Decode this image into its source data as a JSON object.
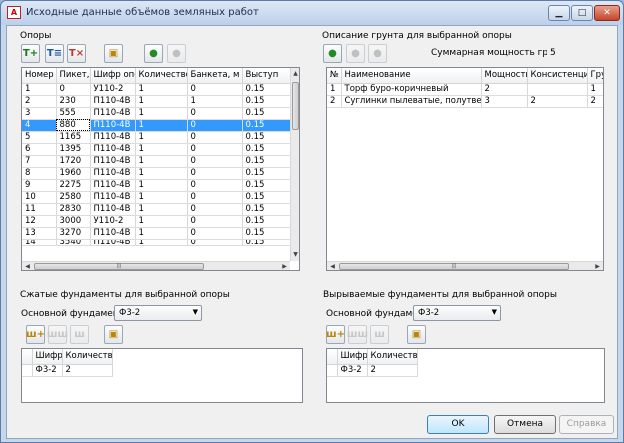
{
  "window": {
    "title": "Исходные данные объёмов земляных работ",
    "app_icon": "autocad-icon",
    "buttons": [
      "minimize-icon",
      "maximize-icon",
      "close-icon"
    ]
  },
  "supports": {
    "section_label": "Опоры",
    "headers": [
      "Номер",
      "Пикет, м",
      "Шифр опоры",
      "Количество",
      "Банкета, м",
      "Выступ"
    ],
    "rows": [
      [
        "1",
        "0",
        "У110-2",
        "1",
        "0",
        "0.15"
      ],
      [
        "2",
        "230",
        "П110-4В",
        "1",
        "1",
        "0.15"
      ],
      [
        "3",
        "555",
        "П110-4В",
        "1",
        "0",
        "0.15"
      ],
      [
        "4",
        "880",
        "П110-4В",
        "1",
        "0",
        "0.15"
      ],
      [
        "5",
        "1165",
        "П110-4В",
        "1",
        "0",
        "0.15"
      ],
      [
        "6",
        "1395",
        "П110-4В",
        "1",
        "0",
        "0.15"
      ],
      [
        "7",
        "1720",
        "П110-4В",
        "1",
        "0",
        "0.15"
      ],
      [
        "8",
        "1960",
        "П110-4В",
        "1",
        "0",
        "0.15"
      ],
      [
        "9",
        "2275",
        "П110-4В",
        "1",
        "0",
        "0.15"
      ],
      [
        "10",
        "2580",
        "П110-4В",
        "1",
        "0",
        "0.15"
      ],
      [
        "11",
        "2830",
        "П110-4В",
        "1",
        "0",
        "0.15"
      ],
      [
        "12",
        "3000",
        "У110-2",
        "1",
        "0",
        "0.15"
      ],
      [
        "13",
        "3270",
        "П110-4В",
        "1",
        "0",
        "0.15"
      ]
    ],
    "partial_row": [
      "14",
      "3540",
      "П110-4В",
      "1",
      "0",
      "0.15"
    ],
    "selected_row": 3,
    "toolbar_icons": [
      "add-row-icon",
      "insert-row-icon",
      "delete-row-icon",
      "import-icon",
      "palette-icon",
      "palette-disabled-icon"
    ]
  },
  "soil": {
    "section_label": "Описание грунта для выбранной опоры",
    "total_label": "Суммарная мощность грунта",
    "total_value": "5",
    "headers": [
      "№",
      "Наименование",
      "Мощность",
      "Консистенция",
      "Гру"
    ],
    "rows": [
      [
        "1",
        "Торф буро-коричневый",
        "2",
        "",
        "1"
      ],
      [
        "2",
        "Суглинки пылеватые, полутвердые",
        "3",
        "2",
        "2"
      ]
    ],
    "toolbar_icons": [
      "palette-icon",
      "palette-disabled-icon",
      "palette-disabled-icon"
    ]
  },
  "compressed": {
    "section_label": "Сжатые фундаменты для выбранной опоры",
    "main_label": "Основной фундамент",
    "main_value": "Ф3-2",
    "headers": [
      "Шифр",
      "Количество"
    ],
    "rows": [
      [
        "Ф3-2",
        "2"
      ]
    ],
    "toolbar_icons": [
      "add-foundation-icon",
      "edit-foundation-icon",
      "delete-foundation-icon",
      "import-foundation-icon"
    ]
  },
  "pulled": {
    "section_label": "Вырываемые фундаменты для выбранной опоры",
    "main_label": "Основной фундамент",
    "main_value": "Ф3-2",
    "headers": [
      "Шифр",
      "Количество"
    ],
    "rows": [
      [
        "Ф3-2",
        "2"
      ]
    ],
    "toolbar_icons": [
      "add-foundation-icon",
      "edit-foundation-icon",
      "delete-foundation-icon",
      "import-foundation-icon"
    ]
  },
  "footer": {
    "ok": "OK",
    "cancel": "Отмена",
    "help": "Справка"
  }
}
